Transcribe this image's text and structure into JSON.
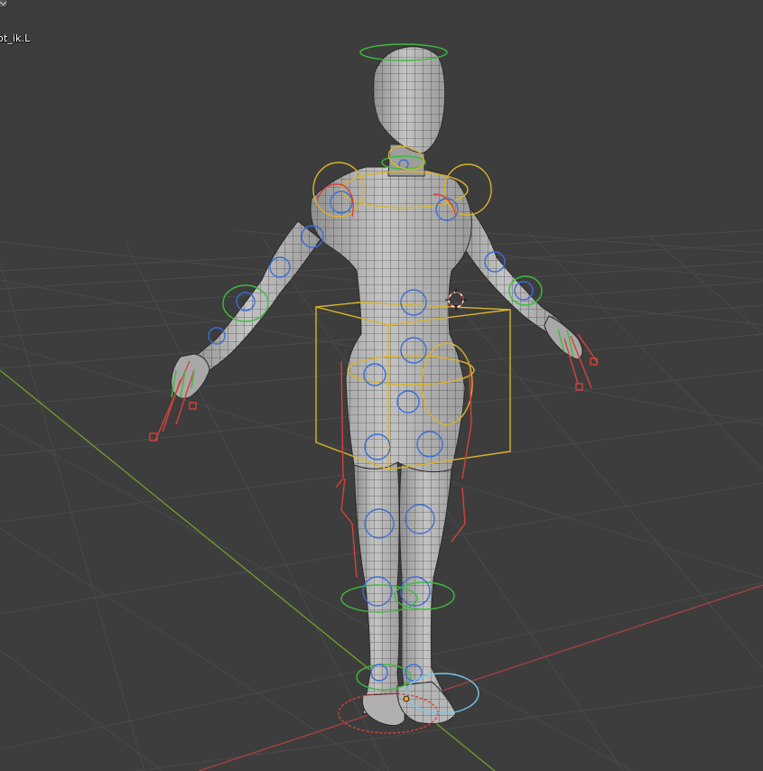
{
  "viewport": {
    "active_object_label": "ot_ik.L",
    "background_color": "#3d3d3d",
    "grid_color": "#4a4a4a",
    "x_axis_color": "#a5413c",
    "y_axis_color": "#6c9a2e",
    "mesh_color": "#b9b9b9",
    "wire_color": "#2a2a2a",
    "rig_colors": {
      "green": "#3dbb3d",
      "blue": "#3a6dd8",
      "red": "#d6423a",
      "yellow": "#d9b32a",
      "cyan": "#74c8e8",
      "bone_wire": "#9b7b3e"
    }
  },
  "header": {
    "menu_icon": "chevron-down-icon"
  },
  "overlay": {
    "origin_marker": "object-origin-icon",
    "cursor_marker": "3d-cursor-icon"
  }
}
